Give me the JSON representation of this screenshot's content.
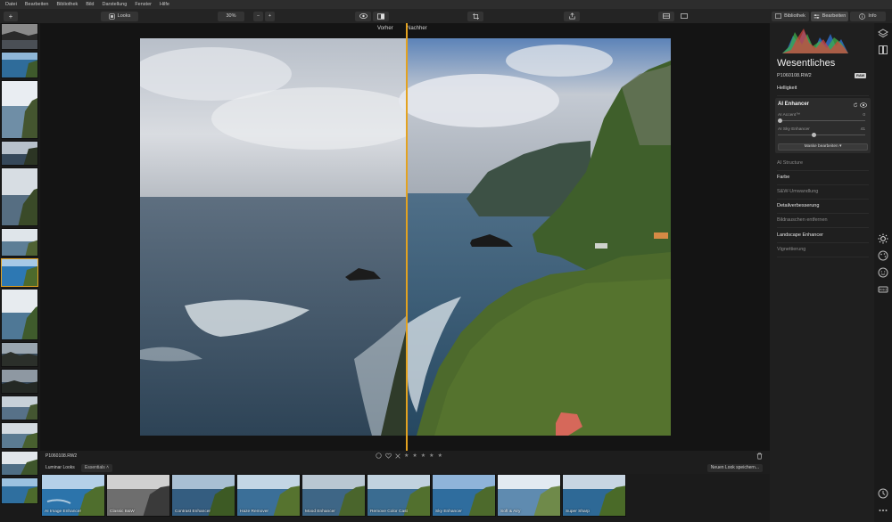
{
  "menu": [
    "Datei",
    "Bearbeiten",
    "Bibliothek",
    "Bild",
    "Darstellung",
    "Fenster",
    "Hilfe"
  ],
  "toolbar": {
    "add_label": "+",
    "looks_label": "Looks",
    "zoom_value": "30%",
    "zoom_minus": "−",
    "zoom_plus": "+",
    "tab_library": "Bibliothek",
    "tab_edit": "Bearbeiten",
    "tab_info": "Info"
  },
  "canvas": {
    "before_label": "Vorher",
    "after_label": "Nachher"
  },
  "bottombar": {
    "filename": "P1060108.RW2",
    "stars": [
      "★",
      "★",
      "★",
      "★",
      "★"
    ]
  },
  "looksbar": {
    "label": "Luminar Looks",
    "collection": "Essentials",
    "save_button": "Neuen Look speichern...",
    "looks": [
      "AI Image Enhancer",
      "Classic B&W",
      "Contrast Enhancer",
      "Haze Remover",
      "Mood Enhancer",
      "Remove Color Cast",
      "Sky Enhancer",
      "Soft & Airy",
      "Super Sharp"
    ]
  },
  "panel": {
    "title": "Wesentliches",
    "file": "P1060108.RW2",
    "raw_badge": "RAW",
    "sections_top": [
      "Helligkeit"
    ],
    "ai": {
      "title": "AI Enhancer",
      "accent_label": "AI Accent™",
      "accent_value": "0",
      "accent_level": 0.0,
      "sky_label": "AI Sky Enhancer",
      "sky_value": "41",
      "sky_level": 0.41,
      "mask_button": "Maske bearbeiten ▾"
    },
    "sections": [
      {
        "label": "AI Structure",
        "active": false
      },
      {
        "label": "Farbe",
        "active": true
      },
      {
        "label": "S&W-Umwandlung",
        "active": false
      },
      {
        "label": "Detailverbesserung",
        "active": true
      },
      {
        "label": "Bildrauschen entfernen",
        "active": false
      },
      {
        "label": "Landscape Enhancer",
        "active": true
      },
      {
        "label": "Vignettierung",
        "active": false
      }
    ]
  },
  "colors": {
    "accent": "#e3a220",
    "sea": "#3d5a70",
    "sky": "#c9ced6",
    "cliff_green": "#4d6a2c"
  }
}
